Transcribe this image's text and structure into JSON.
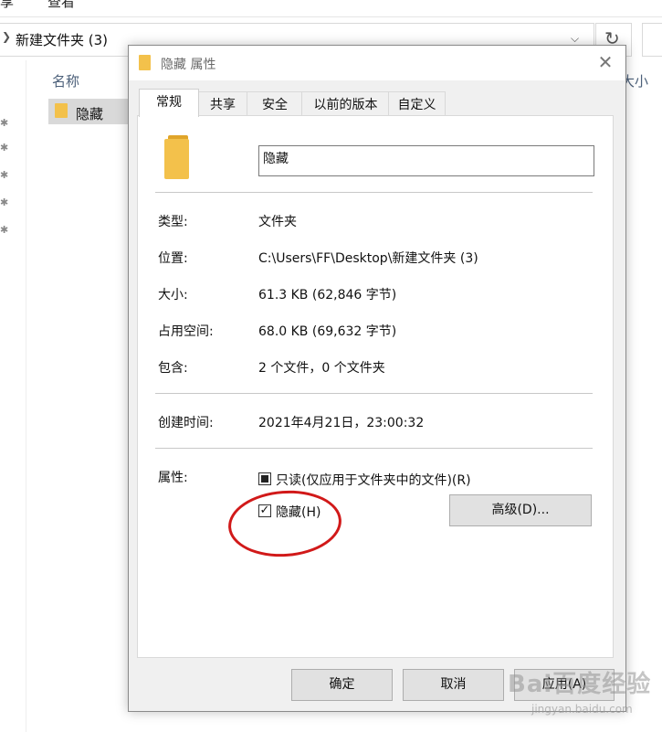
{
  "explorer": {
    "ribbon_tabs": [
      "享",
      "查看"
    ],
    "address_path": "新建文件夹 (3)",
    "column_name": "名称",
    "column_size": "大小",
    "selected_file": "隐藏"
  },
  "dialog": {
    "title": "隐藏 属性",
    "tabs": [
      "常规",
      "共享",
      "安全",
      "以前的版本",
      "自定义"
    ],
    "folder_name": "隐藏",
    "properties": [
      {
        "label": "类型:",
        "value": "文件夹"
      },
      {
        "label": "位置:",
        "value": "C:\\Users\\FF\\Desktop\\新建文件夹 (3)"
      },
      {
        "label": "大小:",
        "value": "61.3 KB (62,846 字节)"
      },
      {
        "label": "占用空间:",
        "value": "68.0 KB (69,632 字节)"
      },
      {
        "label": "包含:",
        "value": "2 个文件，0 个文件夹"
      },
      {
        "label": "创建时间:",
        "value": "2021年4月21日，23:00:32"
      }
    ],
    "attributes_label": "属性:",
    "readonly_label": "只读(仅应用于文件夹中的文件)(R)",
    "hidden_label": "隐藏(H)",
    "hidden_checked": true,
    "advanced_button": "高级(D)...",
    "ok_button": "确定",
    "cancel_button": "取消",
    "apply_button": "应用(A)"
  },
  "annotation_color": "#d11919",
  "watermark": {
    "line1": "Bai百度经验",
    "line2": "jingyan.baidu.com"
  }
}
